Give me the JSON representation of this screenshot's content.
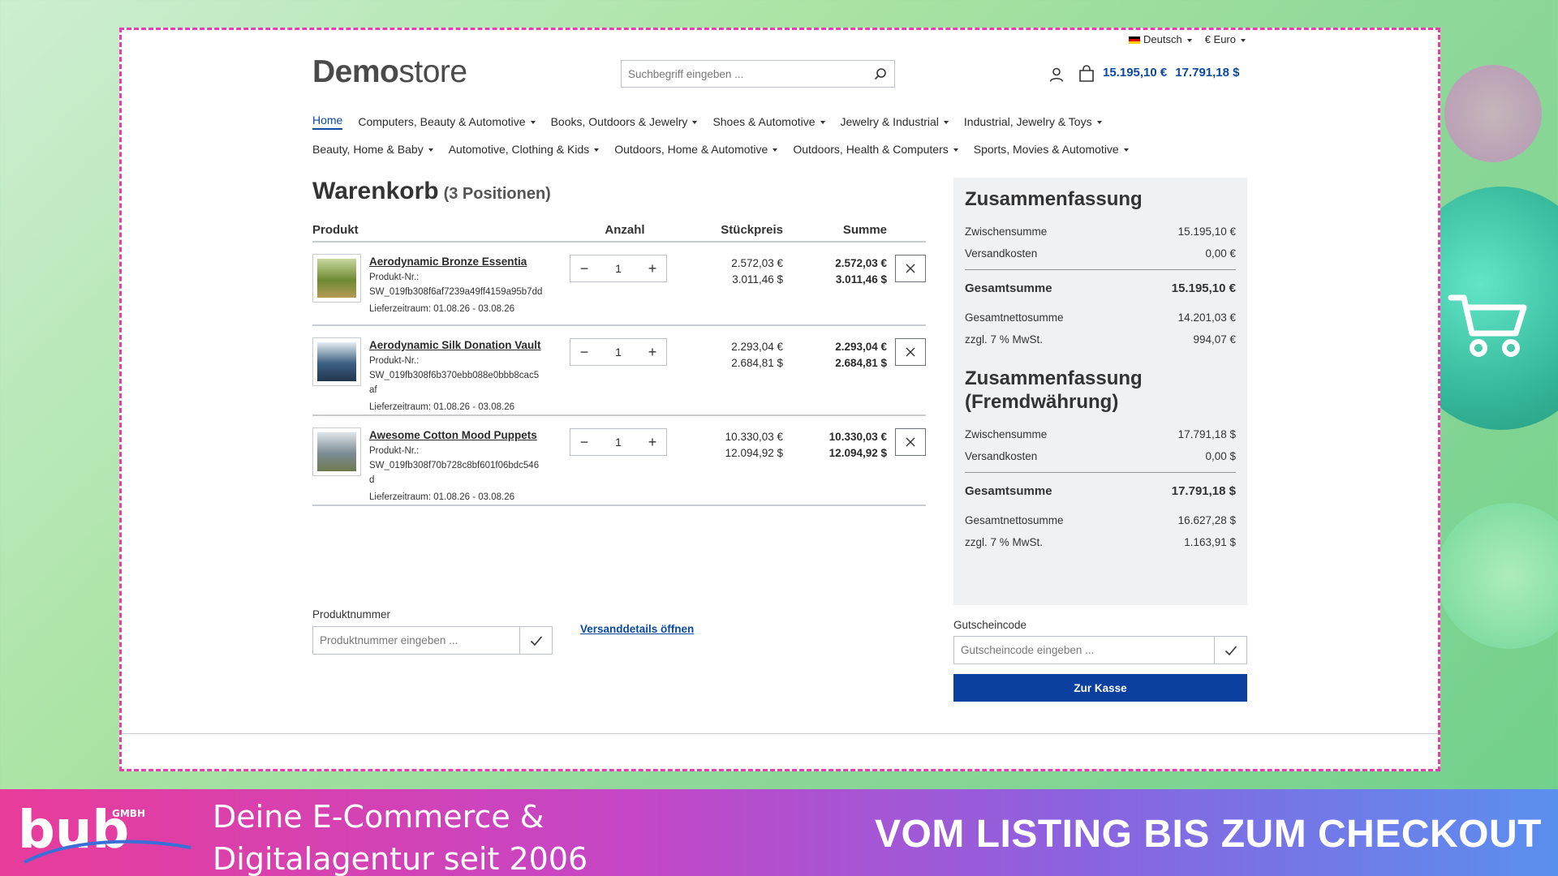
{
  "topbar": {
    "language": "Deutsch",
    "currency": "€ Euro"
  },
  "logo": {
    "bold": "Demo",
    "light": "store"
  },
  "search": {
    "placeholder": "Suchbegriff eingeben ..."
  },
  "header_cart": {
    "total_eur": "15.195,10 €",
    "total_usd": "17.791,18 $"
  },
  "nav": {
    "row1": [
      {
        "label": "Home",
        "caret": false
      },
      {
        "label": "Computers, Beauty & Automotive",
        "caret": true
      },
      {
        "label": "Books, Outdoors & Jewelry",
        "caret": true
      },
      {
        "label": "Shoes & Automotive",
        "caret": true
      },
      {
        "label": "Jewelry & Industrial",
        "caret": true
      },
      {
        "label": "Industrial, Jewelry & Toys",
        "caret": true
      }
    ],
    "row2": [
      {
        "label": "Beauty, Home & Baby",
        "caret": true
      },
      {
        "label": "Automotive, Clothing & Kids",
        "caret": true
      },
      {
        "label": "Outdoors, Home & Automotive",
        "caret": true
      },
      {
        "label": "Outdoors, Health & Computers",
        "caret": true
      },
      {
        "label": "Sports, Movies & Automotive",
        "caret": true
      }
    ]
  },
  "cart": {
    "title": "Warenkorb",
    "count": "(3 Positionen)",
    "columns": {
      "product": "Produkt",
      "qty": "Anzahl",
      "unit_price": "Stückpreis",
      "sum": "Summe"
    },
    "items": [
      {
        "name": "Aerodynamic Bronze Essentia",
        "sku_label": "Produkt-Nr.:",
        "sku": "SW_019fb308f6af7239a49ff4159a95b7dd",
        "delivery": "Lieferzeitraum: 01.08.26 - 03.08.26",
        "qty": "1",
        "price_eur": "2.572,03 €",
        "price_usd": "3.011,46 $",
        "sum_eur": "2.572,03 €",
        "sum_usd": "3.011,46 $",
        "thumb_colors": [
          "#c9d7a0",
          "#6d8a32",
          "#b59a55"
        ]
      },
      {
        "name": "Aerodynamic Silk Donation Vault",
        "sku_label": "Produkt-Nr.:",
        "sku": "SW_019fb308f6b370ebb088e0bbb8cac5af",
        "delivery": "Lieferzeitraum: 01.08.26 - 03.08.26",
        "qty": "1",
        "price_eur": "2.293,04 €",
        "price_usd": "2.684,81 $",
        "sum_eur": "2.293,04 €",
        "sum_usd": "2.684,81 $",
        "thumb_colors": [
          "#e6edf2",
          "#3b5f82",
          "#23374d"
        ]
      },
      {
        "name": "Awesome Cotton Mood Puppets",
        "sku_label": "Produkt-Nr.:",
        "sku": "SW_019fb308f70b728c8bf601f06bdc546d",
        "delivery": "Lieferzeitraum: 01.08.26 - 03.08.26",
        "qty": "1",
        "price_eur": "10.330,03 €",
        "price_usd": "12.094,92 $",
        "sum_eur": "10.330,03 €",
        "sum_usd": "12.094,92 $",
        "thumb_colors": [
          "#dfe5ea",
          "#7b8b93",
          "#6f7a4e"
        ]
      }
    ],
    "product_number": {
      "label": "Produktnummer",
      "placeholder": "Produktnummer eingeben ..."
    },
    "shipping_link": "Versanddetails öffnen"
  },
  "summary": {
    "title": "Zusammenfassung",
    "subtotal_label": "Zwischensumme",
    "subtotal": "15.195,10 €",
    "shipping_label": "Versandkosten",
    "shipping": "0,00 €",
    "total_label": "Gesamtsumme",
    "total": "15.195,10 €",
    "net_label": "Gesamtnettosumme",
    "net": "14.201,03 €",
    "tax_label": "zzgl. 7 % MwSt.",
    "tax": "994,07 €"
  },
  "summary_foreign": {
    "title": "Zusammenfassung (Fremdwährung)",
    "subtotal_label": "Zwischensumme",
    "subtotal": "17.791,18 $",
    "shipping_label": "Versandkosten",
    "shipping": "0,00 $",
    "total_label": "Gesamtsumme",
    "total": "17.791,18 $",
    "net_label": "Gesamtnettosumme",
    "net": "16.627,28 $",
    "tax_label": "zzgl. 7 % MwSt.",
    "tax": "1.163,91 $"
  },
  "coupon": {
    "label": "Gutscheincode",
    "placeholder": "Gutscheincode eingeben ..."
  },
  "checkout_button": "Zur Kasse",
  "banner": {
    "brand_logo_text": "bub GMBH",
    "tagline_line1": "Deine E-Commerce &",
    "tagline_line2": "Digitalagentur seit 2006",
    "headline": "VOM LISTING BIS ZUM CHECKOUT"
  },
  "colors": {
    "accent": "#0b3fa0",
    "frame_border": "#e93bb0",
    "banner_start": "#e83c9a",
    "banner_end": "#5a8fef"
  }
}
